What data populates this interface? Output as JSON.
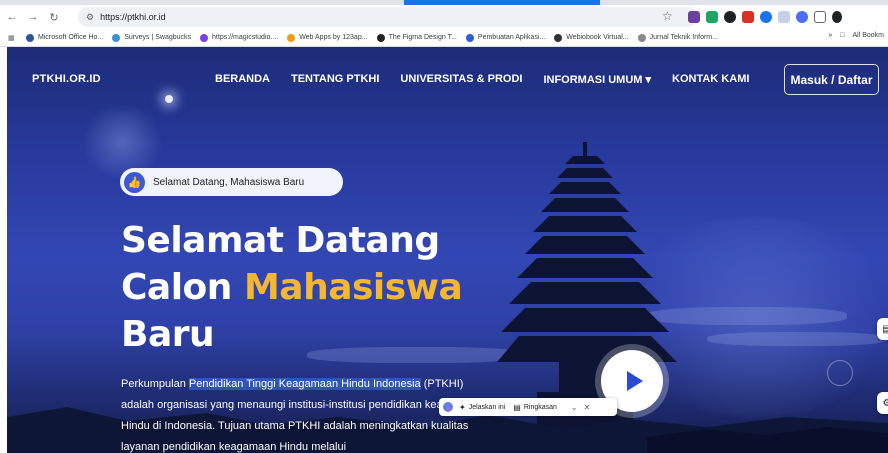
{
  "browser": {
    "url": "https://ptkhi.or.id",
    "bookmarks": [
      {
        "label": "Microsoft Office Ho...",
        "color": "#2b579a"
      },
      {
        "label": "Surveys | Swagbucks",
        "color": "#3b8fd8"
      },
      {
        "label": "https://magicstudio....",
        "color": "#7a3fe4"
      },
      {
        "label": "Web Apps by 123ap...",
        "color": "#f39c12"
      },
      {
        "label": "The Figma Design T...",
        "color": "#222222"
      },
      {
        "label": "Pembuatan Aplikasi...",
        "color": "#2f5bd6"
      },
      {
        "label": "Webiobook Virtual...",
        "color": "#333333"
      },
      {
        "label": "Jurnal Teknik Inform...",
        "color": "#888888"
      }
    ],
    "more": "»",
    "all_bookmarks": "All Bookm"
  },
  "site": {
    "brand": "PTKHI.OR.ID",
    "menu": [
      "BERANDA",
      "TENTANG PTKHI",
      "UNIVERSITAS & PRODI",
      "INFORMASI UMUM ▾",
      "KONTAK KAMI"
    ],
    "login": "Masuk / Daftar",
    "badge": "Selamat Datang, Mahasiswa Baru",
    "title_line1": "Selamat Datang",
    "title_line2_a": "Calon ",
    "title_line2_b": "Mahasiswa",
    "title_line3": "Baru",
    "desc_pre": "Perkumpulan ",
    "desc_highlight": "Pendidikan Tinggi Keagamaan Hindu Indonesia",
    "desc_post": " (PTKHI) adalah organisasi yang menaungi institusi-institusi pendidikan keagamaan Hindu di Indonesia. Tujuan utama PTKHI adalah meningkatkan kualitas layanan pendidikan keagamaan Hindu melalui"
  },
  "assistant": {
    "explain": "Jelaskan ini",
    "summary": "Ringkasan",
    "chevron": "⌄",
    "close": "✕"
  },
  "colors": {
    "accent": "#f5b731",
    "brand_blue": "#2b4ad3"
  }
}
